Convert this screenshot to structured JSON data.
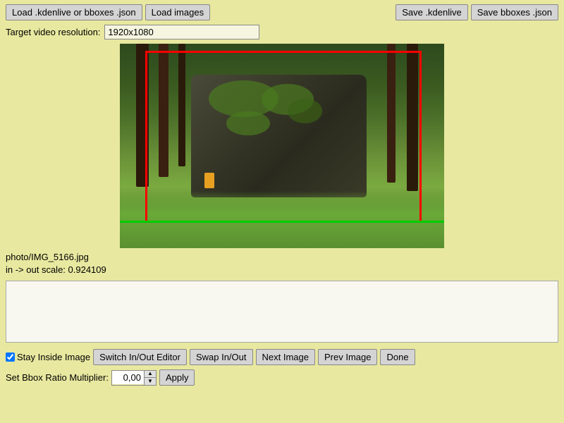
{
  "toolbar": {
    "load_kdenlive_label": "Load .kdenlive or bboxes .json",
    "load_images_label": "Load images",
    "save_kdenlive_label": "Save .kdenlive",
    "save_bboxes_label": "Save bboxes .json"
  },
  "resolution": {
    "label": "Target video resolution:",
    "value": "1920x1080"
  },
  "image_info": {
    "filename": "photo/IMG_5166.jpg",
    "scale": "in -> out scale: 0.924109"
  },
  "bottom_toolbar": {
    "stay_inside_label": "Stay Inside Image",
    "switch_editor_label": "Switch In/Out Editor",
    "swap_label": "Swap In/Out",
    "next_image_label": "Next Image",
    "prev_image_label": "Prev Image",
    "done_label": "Done"
  },
  "bbox_ratio": {
    "label": "Set Bbox Ratio Multiplier:",
    "value": "0,00",
    "apply_label": "Apply"
  },
  "textarea_content": ""
}
